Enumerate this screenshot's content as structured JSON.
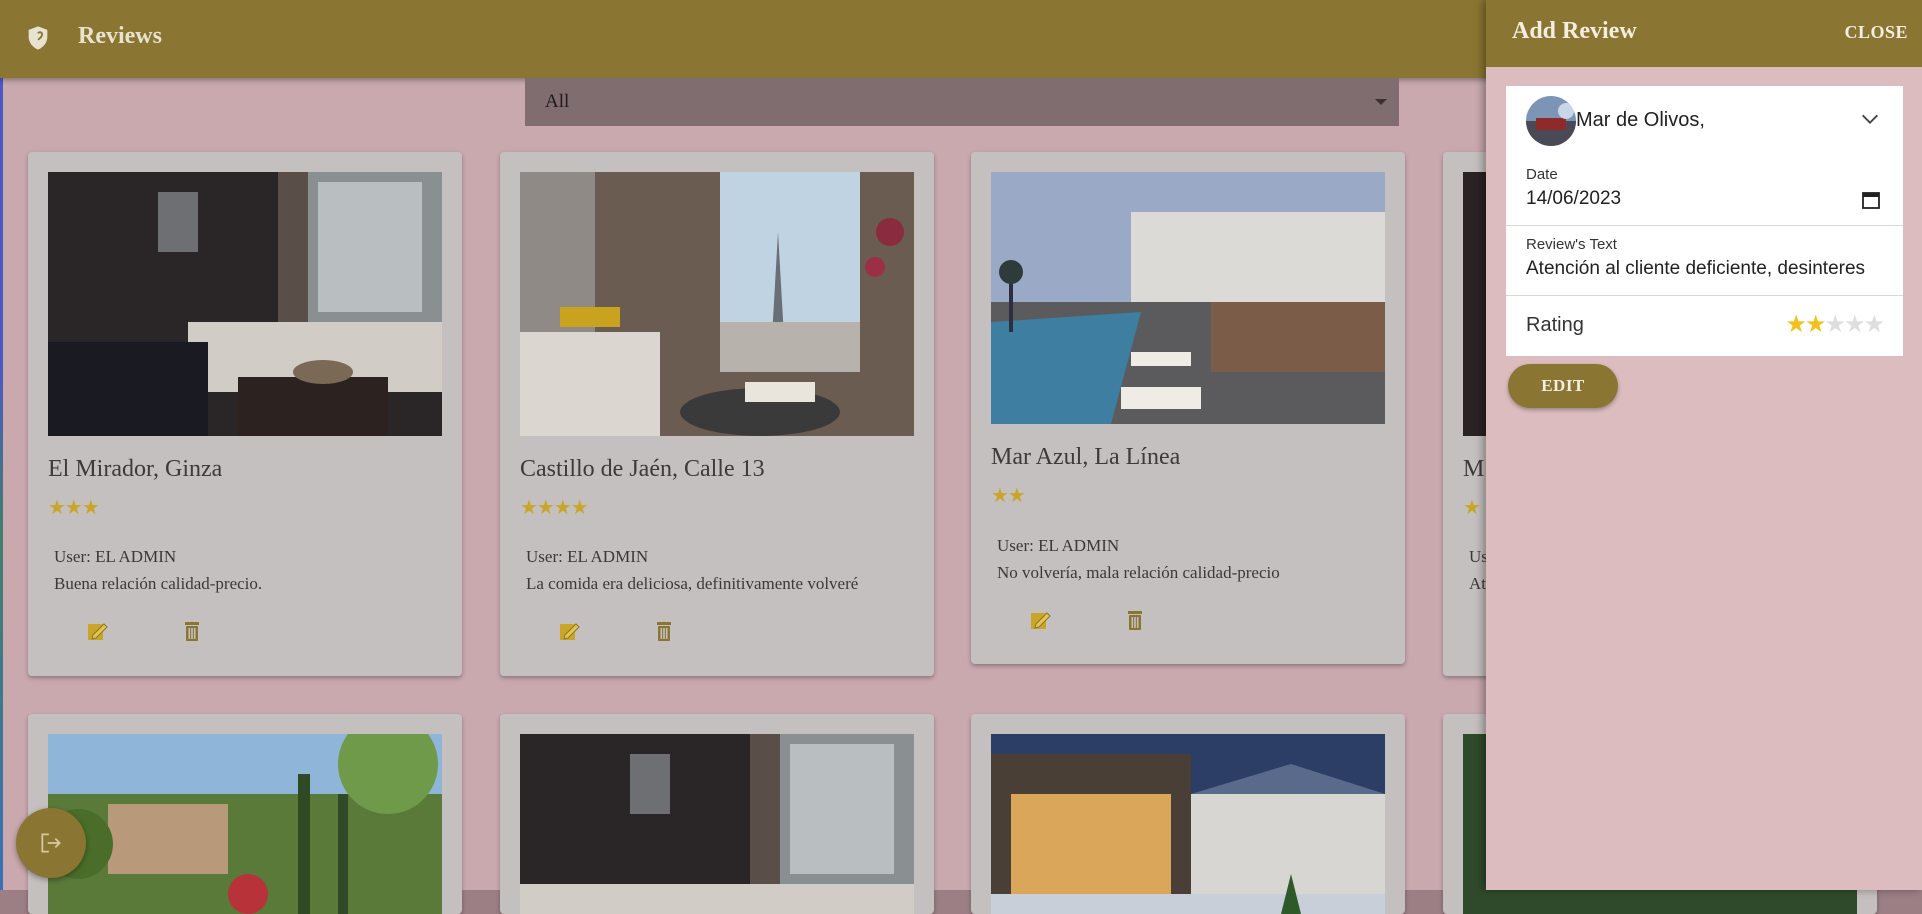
{
  "app": {
    "title": "Reviews"
  },
  "filter": {
    "selected": "All"
  },
  "cards": [
    {
      "name": "El Mirador, Ginza",
      "stars": "★★★",
      "user": "User: EL ADMIN",
      "text": "Buena relación calidad-precio."
    },
    {
      "name": "Castillo de Jaén, Calle 13",
      "stars": "★★★★",
      "user": "User: EL ADMIN",
      "text": "La comida era deliciosa, definitivamente volveré"
    },
    {
      "name": "Mar Azul, La Línea",
      "stars": "★★",
      "user": "User: EL ADMIN",
      "text": "No volvería, mala relación calidad-precio"
    },
    {
      "name": "M",
      "stars": "★",
      "user": "Us",
      "text": "At"
    }
  ],
  "drawer": {
    "title": "Add Review",
    "close_label": "CLOSE",
    "hotel": "Mar de Olivos,",
    "date_label": "Date",
    "date_value": "14/06/2023",
    "text_label": "Review's Text",
    "text_value": "Atención al cliente deficiente, desinteres",
    "rating_label": "Rating",
    "rating": 2,
    "rating_max": 5,
    "submit_label": "EDIT"
  },
  "colors": {
    "primary": "#8a7532",
    "star": "#f2c21a",
    "card_star": "#c9a629"
  }
}
